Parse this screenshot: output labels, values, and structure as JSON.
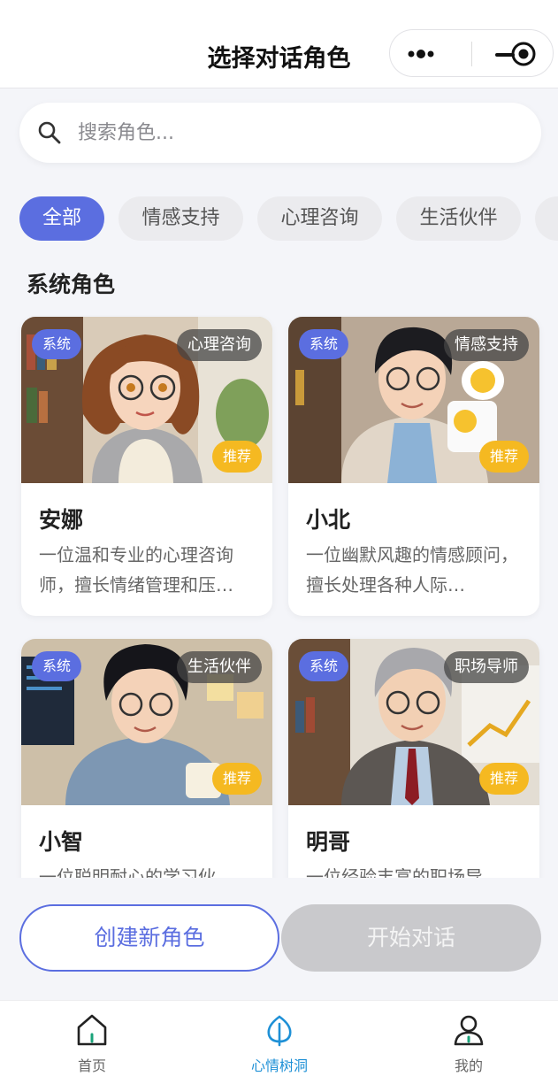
{
  "header": {
    "title": "选择对话角色",
    "more_icon": "more-dots-icon",
    "minimize_icon": "minimize-icon",
    "close_icon": "target-circle-icon"
  },
  "search": {
    "placeholder": "搜索角色...",
    "value": "",
    "icon": "search-icon"
  },
  "categories": {
    "items": [
      "全部",
      "情感支持",
      "心理咨询",
      "生活伙伴"
    ],
    "active": "全部"
  },
  "section": {
    "title": "系统角色"
  },
  "cards": [
    {
      "name": "安娜",
      "system_badge": "系统",
      "category": "心理咨询",
      "recommend": "推荐",
      "description": "一位温和专业的心理咨询师，擅长情绪管理和压…"
    },
    {
      "name": "小北",
      "system_badge": "系统",
      "category": "情感支持",
      "recommend": "推荐",
      "description": "一位幽默风趣的情感顾问，擅长处理各种人际…"
    },
    {
      "name": "小智",
      "system_badge": "系统",
      "category": "生活伙伴",
      "recommend": "推荐",
      "description": "一位聪明耐心的学习伙…"
    },
    {
      "name": "明哥",
      "system_badge": "系统",
      "category": "职场导师",
      "recommend": "推荐",
      "description": "一位经验丰富的职场导…"
    }
  ],
  "actions": {
    "create_label": "创建新角色",
    "start_label": "开始对话",
    "start_disabled": true
  },
  "tabbar": {
    "items": [
      {
        "label": "首页",
        "icon": "home-icon"
      },
      {
        "label": "心情树洞",
        "icon": "leaf-icon"
      },
      {
        "label": "我的",
        "icon": "person-icon"
      }
    ],
    "active": "心情树洞"
  },
  "colors": {
    "accent": "#5b6ee0",
    "recommend": "#f5b921",
    "tab_active": "#1e90d6",
    "disabled": "#c9c9cc"
  }
}
